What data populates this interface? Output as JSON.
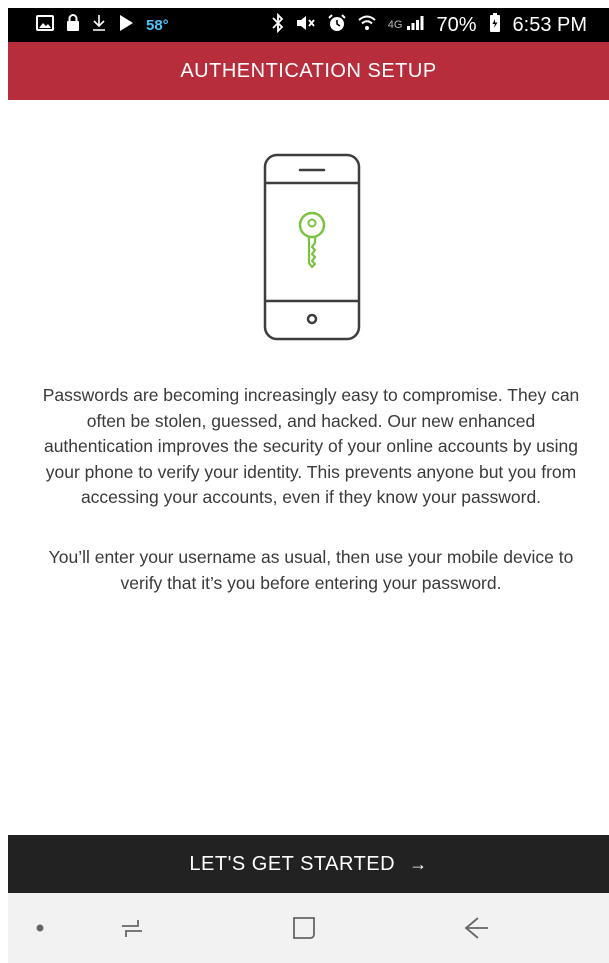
{
  "status_bar": {
    "temperature": "58°",
    "network_type": "4G",
    "battery": "70%",
    "time": "6:53 PM",
    "left_icons": [
      "gallery-icon",
      "lock-icon",
      "download-icon",
      "play-store-icon"
    ],
    "right_icons": [
      "bluetooth-icon",
      "mute-icon",
      "alarm-icon",
      "wifi-icon",
      "signal-icon",
      "battery-icon"
    ]
  },
  "header": {
    "title": "AUTHENTICATION SETUP",
    "color": "#b72d3c"
  },
  "content": {
    "illustration_icon": "phone-with-key-icon",
    "accent_color": "#7cc242",
    "paragraphs": [
      "Passwords are becoming increasingly easy to compromise. They can often be stolen, guessed, and hacked. Our new enhanced authentication improves the security of your online accounts by using your phone to verify your identity. This prevents anyone but you from accessing your accounts, even if they know your password.",
      "You’ll enter your username as usual, then use your mobile device to verify that it’s you before entering your password."
    ]
  },
  "cta": {
    "label": "LET'S GET STARTED",
    "arrow": "→",
    "color": "#222222"
  },
  "nav_bar": {
    "buttons": [
      "dot-icon",
      "recents-icon",
      "home-icon",
      "back-icon"
    ]
  }
}
